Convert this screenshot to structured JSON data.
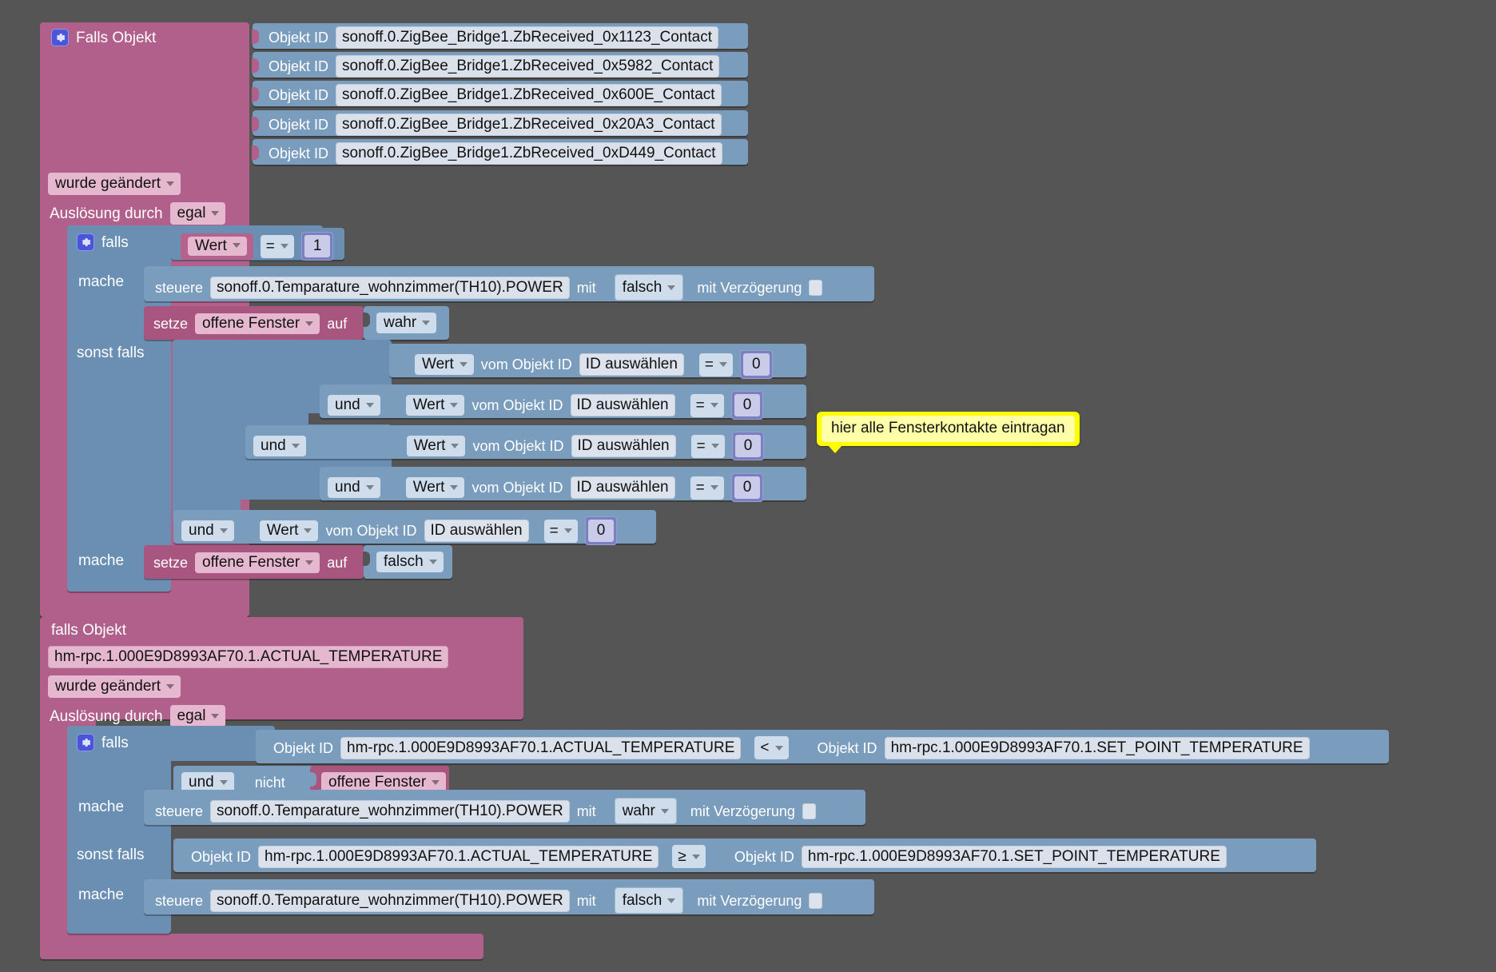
{
  "workspace": {
    "background_color": "#555555",
    "block_colors": {
      "event_pink": "#b0608a",
      "control_blue": "#6b8fb3",
      "field_light": "#dde3ec",
      "dropdown_pink": "#e6b8cf",
      "dropdown_blue": "#cfdceb",
      "number_purple": "#7a7fc0",
      "comment_yellow": "#ffff00",
      "gear_blue": "#4a55d8"
    }
  },
  "script1": {
    "title": "Falls Objekt",
    "gear_icon": "gear-icon",
    "object_id_label": "Objekt ID",
    "object_ids": [
      "sonoff.0.ZigBee_Bridge1.ZbReceived_0x1123_Contact",
      "sonoff.0.ZigBee_Bridge1.ZbReceived_0x5982_Contact",
      "sonoff.0.ZigBee_Bridge1.ZbReceived_0x600E_Contact",
      "sonoff.0.ZigBee_Bridge1.ZbReceived_0x20A3_Contact",
      "sonoff.0.ZigBee_Bridge1.ZbReceived_0xD449_Contact"
    ],
    "change_mode": "wurde geändert",
    "trigger_label": "Auslösung durch",
    "trigger_mode": "egal",
    "if_block": {
      "if_label": "falls",
      "condition": {
        "value_field": "Wert",
        "operator": "=",
        "number": "1"
      },
      "do_label": "mache",
      "do_statements": [
        {
          "verb": "steuere",
          "target": "sonoff.0.Temparature_wohnzimmer(TH10).POWER",
          "with_label": "mit",
          "value": "falsch",
          "delay_label": "mit Verzögerung",
          "delay_checked": false
        },
        {
          "verb": "setze",
          "variable": "offene Fenster",
          "to_label": "auf",
          "value": "wahr"
        }
      ],
      "elseif_label": "sonst falls",
      "elseif_conditions": [
        {
          "value_field": "Wert",
          "from_label": "vom Objekt ID",
          "object_id": "ID auswählen",
          "operator": "=",
          "number": "0"
        },
        {
          "value_field": "Wert",
          "from_label": "vom Objekt ID",
          "object_id": "ID auswählen",
          "operator": "=",
          "number": "0"
        },
        {
          "value_field": "Wert",
          "from_label": "vom Objekt ID",
          "object_id": "ID auswählen",
          "operator": "=",
          "number": "0"
        },
        {
          "value_field": "Wert",
          "from_label": "vom Objekt ID",
          "object_id": "ID auswählen",
          "operator": "=",
          "number": "0"
        },
        {
          "value_field": "Wert",
          "from_label": "vom Objekt ID",
          "object_id": "ID auswählen",
          "operator": "=",
          "number": "0"
        }
      ],
      "and_label": "und",
      "elseif_do_label": "mache",
      "elseif_do_statement": {
        "verb": "setze",
        "variable": "offene Fenster",
        "to_label": "auf",
        "value": "falsch"
      }
    },
    "comment": "hier alle Fensterkontakte eintragan"
  },
  "script2": {
    "title": "falls Objekt",
    "object_id": "hm-rpc.1.000E9D8993AF70.1.ACTUAL_TEMPERATURE",
    "change_mode": "wurde geändert",
    "trigger_label": "Auslösung durch",
    "trigger_mode": "egal",
    "if_block": {
      "if_label": "falls",
      "gear_icon": "gear-icon",
      "condition_a": {
        "left_label": "Objekt ID",
        "left_value": "hm-rpc.1.000E9D8993AF70.1.ACTUAL_TEMPERATURE",
        "operator": "<",
        "right_label": "Objekt ID",
        "right_value": "hm-rpc.1.000E9D8993AF70.1.SET_POINT_TEMPERATURE"
      },
      "and_label": "und",
      "not_label": "nicht",
      "not_variable": "offene Fenster",
      "do_label": "mache",
      "do_statement": {
        "verb": "steuere",
        "target": "sonoff.0.Temparature_wohnzimmer(TH10).POWER",
        "with_label": "mit",
        "value": "wahr",
        "delay_label": "mit Verzögerung",
        "delay_checked": false
      },
      "elseif_label": "sonst falls",
      "elseif_condition": {
        "left_label": "Objekt ID",
        "left_value": "hm-rpc.1.000E9D8993AF70.1.ACTUAL_TEMPERATURE",
        "operator": "≥",
        "right_label": "Objekt ID",
        "right_value": "hm-rpc.1.000E9D8993AF70.1.SET_POINT_TEMPERATURE"
      },
      "elseif_do_label": "mache",
      "elseif_do_statement": {
        "verb": "steuere",
        "target": "sonoff.0.Temparature_wohnzimmer(TH10).POWER",
        "with_label": "mit",
        "value": "falsch",
        "delay_label": "mit Verzögerung",
        "delay_checked": false
      }
    }
  }
}
